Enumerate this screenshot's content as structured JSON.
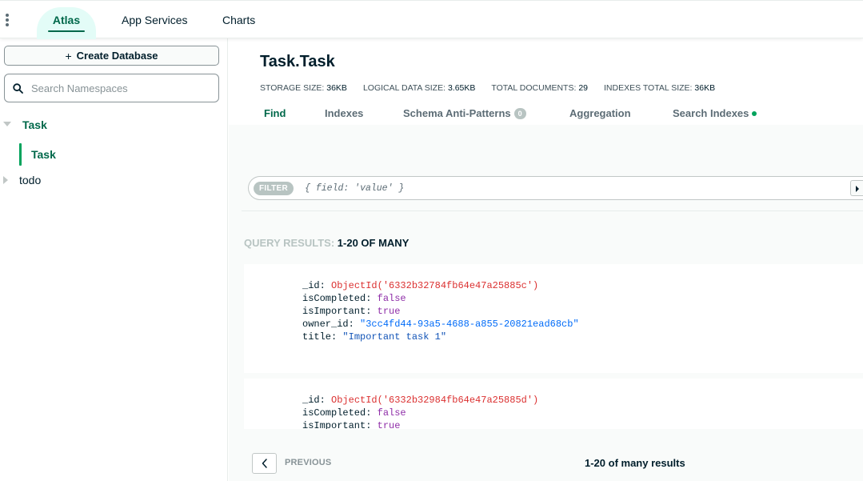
{
  "topnav": {
    "tabs": [
      "Atlas",
      "App Services",
      "Charts"
    ],
    "active": "Atlas"
  },
  "sidebar": {
    "create_label": "Create Database",
    "search_placeholder": "Search Namespaces",
    "databases": [
      {
        "name": "Task",
        "expanded": true,
        "collections": [
          "Task"
        ]
      },
      {
        "name": "todo",
        "expanded": false,
        "collections": []
      }
    ]
  },
  "collection": {
    "title": "Task.Task",
    "stats": [
      {
        "label": "STORAGE SIZE:",
        "value": "36KB"
      },
      {
        "label": "LOGICAL DATA SIZE:",
        "value": "3.65KB"
      },
      {
        "label": "TOTAL DOCUMENTS:",
        "value": "29"
      },
      {
        "label": "INDEXES TOTAL SIZE:",
        "value": "36KB"
      }
    ],
    "tabs": {
      "find": "Find",
      "indexes": "Indexes",
      "schema": "Schema Anti-Patterns",
      "schema_count": "0",
      "aggregation": "Aggregation",
      "search": "Search Indexes"
    }
  },
  "filter": {
    "tag": "FILTER",
    "placeholder": "{ field: 'value' }"
  },
  "results": {
    "label": "QUERY RESULTS:",
    "count": "1-20 OF MANY",
    "documents": [
      {
        "_id": "ObjectId('6332b32784fb64e47a25885c')",
        "isCompleted": "false",
        "isImportant": "true",
        "owner_id": "\"3cc4fd44-93a5-4688-a855-20821ead68cb\"",
        "title": "\"Important task 1\""
      },
      {
        "_id": "ObjectId('6332b32984fb64e47a25885d')",
        "isCompleted": "false",
        "isImportant": "true"
      }
    ]
  },
  "pagination": {
    "previous": "PREVIOUS",
    "summary": "1-20 of many results"
  },
  "colors": {
    "accent": "#00684a",
    "accent_light": "#e3fcf7",
    "objectid": "#db3030",
    "boolean": "#8f2ea8",
    "string": "#016bf8"
  }
}
